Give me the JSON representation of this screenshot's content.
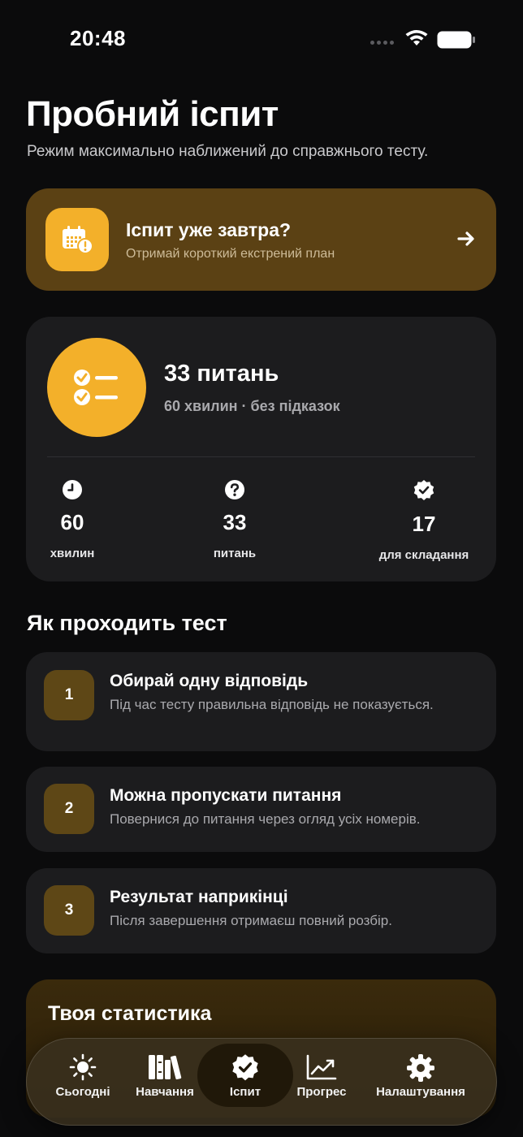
{
  "status_bar": {
    "time": "20:48"
  },
  "header": {
    "title": "Пробний іспит",
    "subtitle": "Режим максимально наближений до справжнього тесту."
  },
  "urgent_card": {
    "title": "Іспит уже завтра?",
    "subtitle": "Отримай короткий екстрений план",
    "icon": "calendar-alert-icon",
    "accent": "#f3b02a",
    "background": "#5b4114"
  },
  "exam_card": {
    "title": "33 питань",
    "subtitle": "60 хвилин · без підказок",
    "stats": [
      {
        "icon": "clock-icon",
        "value": "60",
        "label": "хвилин"
      },
      {
        "icon": "question-icon",
        "value": "33",
        "label": "питань"
      },
      {
        "icon": "check-badge-icon",
        "value": "17",
        "label": "для складання"
      }
    ]
  },
  "how_it_works": {
    "title": "Як проходить тест",
    "steps": [
      {
        "number": "1",
        "title": "Обирай одну відповідь",
        "description": "Під час тесту правильна відповідь не показується."
      },
      {
        "number": "2",
        "title": "Можна пропускати питання",
        "description": "Повернися до питання через огляд усіх номерів."
      },
      {
        "number": "3",
        "title": "Результат наприкінці",
        "description": "Після завершення отримаєш повний розбір."
      }
    ]
  },
  "statistics": {
    "title": "Твоя статистика"
  },
  "tab_bar": {
    "active": "Іспит",
    "tabs": [
      {
        "label": "Сьогодні",
        "icon": "sun-icon"
      },
      {
        "label": "Навчання",
        "icon": "books-icon"
      },
      {
        "label": "Іспит",
        "icon": "check-badge-icon"
      },
      {
        "label": "Прогрес",
        "icon": "chart-icon"
      },
      {
        "label": "Налаштування",
        "icon": "gear-icon"
      }
    ]
  }
}
